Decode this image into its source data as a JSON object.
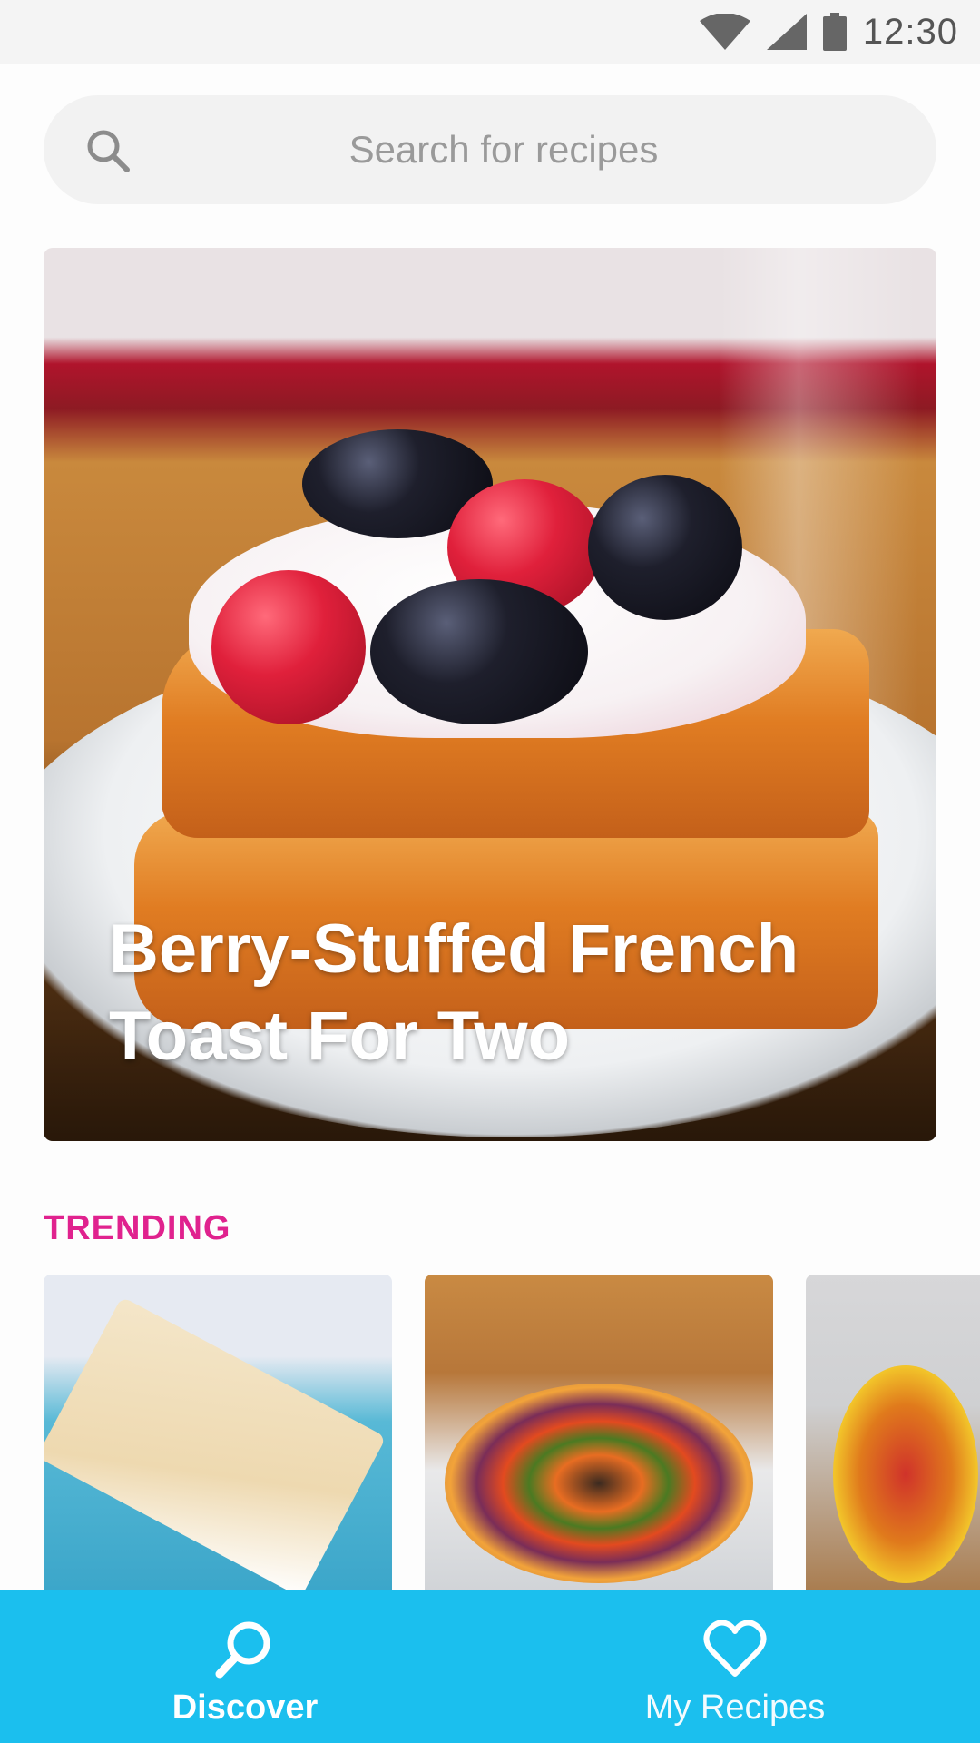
{
  "status_bar": {
    "time": "12:30",
    "icons": [
      "wifi-icon",
      "cellular-signal-icon",
      "battery-icon"
    ]
  },
  "search": {
    "placeholder": "Search for recipes",
    "icon": "search-icon"
  },
  "featured": {
    "title": "Berry-Stuffed French Toast For Two"
  },
  "trending": {
    "label": "TRENDING",
    "items": [
      "funfetti-cake-image",
      "vegetable-tart-image",
      "pineapple-boat-image"
    ]
  },
  "bottom_nav": {
    "items": [
      {
        "label": "Discover",
        "icon": "search-icon",
        "active": true
      },
      {
        "label": "My Recipes",
        "icon": "heart-icon",
        "active": false
      }
    ]
  },
  "colors": {
    "accent": "#1bbfee",
    "trending_label": "#e0228e",
    "search_bg": "#f2f2f2"
  }
}
